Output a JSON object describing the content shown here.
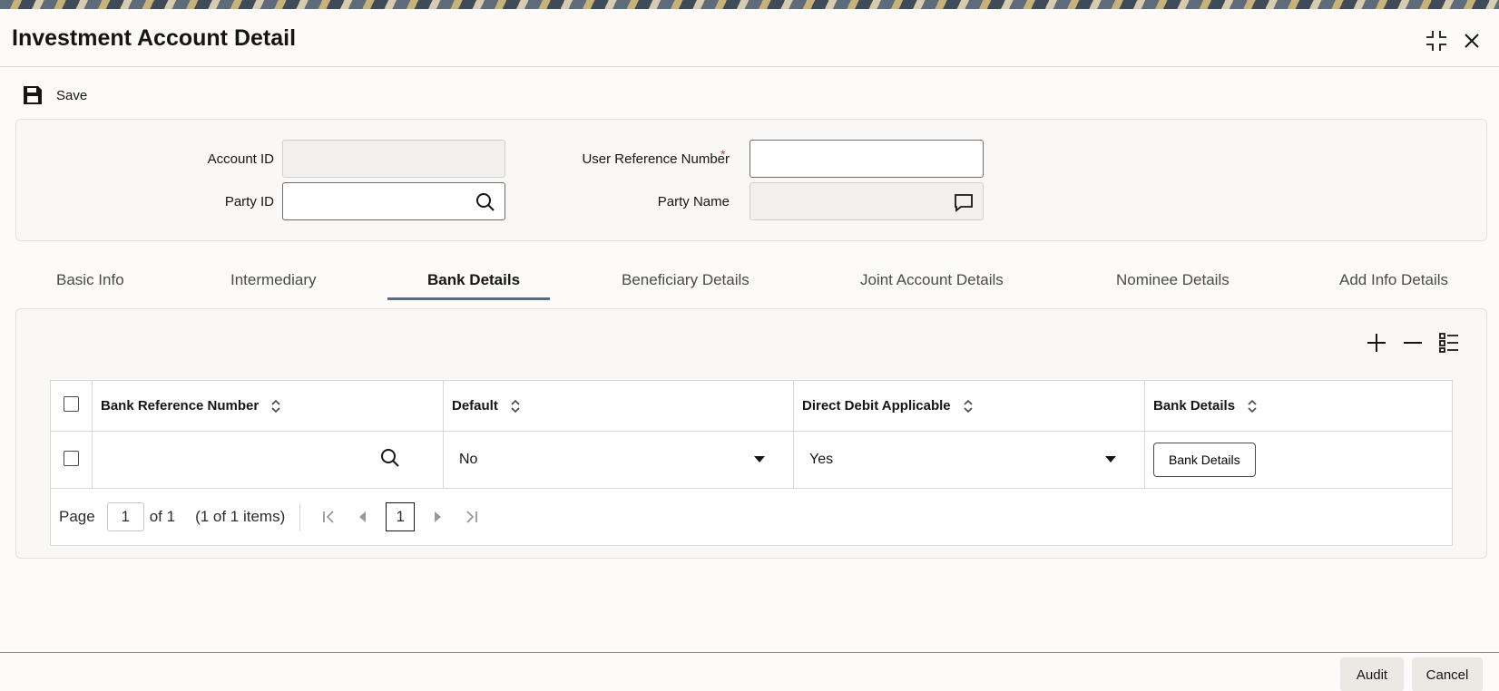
{
  "window": {
    "title": "Investment Account Detail"
  },
  "toolbar": {
    "save_label": "Save"
  },
  "form": {
    "account_id_label": "Account ID",
    "account_id_value": "",
    "party_id_label": "Party ID",
    "party_id_value": "",
    "user_ref_label": "User Reference Number",
    "user_ref_required": "*",
    "user_ref_value": "",
    "party_name_label": "Party Name",
    "party_name_value": ""
  },
  "tabs": [
    {
      "label": "Basic Info"
    },
    {
      "label": "Intermediary"
    },
    {
      "label": "Bank Details",
      "active": true
    },
    {
      "label": "Beneficiary Details"
    },
    {
      "label": "Joint Account Details"
    },
    {
      "label": "Nominee Details"
    },
    {
      "label": "Add Info Details"
    }
  ],
  "grid": {
    "columns": [
      "Bank Reference Number",
      "Default",
      "Direct Debit Applicable",
      "Bank Details"
    ],
    "rows": [
      {
        "bank_ref": "",
        "default": "No",
        "direct_debit": "Yes",
        "bank_details_button": "Bank Details"
      }
    ],
    "icons": {
      "add": "plus-icon",
      "remove": "minus-icon",
      "columns": "list-icon"
    }
  },
  "pager": {
    "page_label": "Page",
    "page_value": "1",
    "of_label": "of 1",
    "items_label": "(1 of 1 items)",
    "current_page": "1"
  },
  "footer": {
    "audit_label": "Audit",
    "cancel_label": "Cancel"
  },
  "colors": {
    "accent": "#5a6a80",
    "required": "#c74634"
  }
}
